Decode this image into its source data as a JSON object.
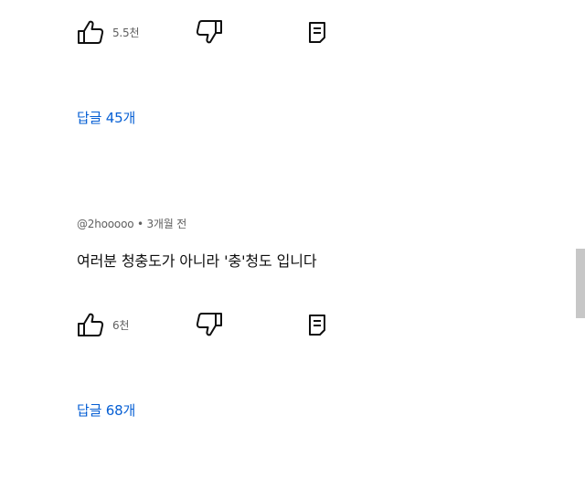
{
  "comments": [
    {
      "like_count": "5.5천",
      "replies_label": "답글 45개"
    },
    {
      "handle": "@2hooooo",
      "separator": "•",
      "time": "3개월 전",
      "text": "여러분 청충도가 아니라 '충'청도 입니다",
      "like_count": "6천",
      "replies_label": "답글 68개"
    }
  ],
  "icons": {
    "like": "thumbs-up-icon",
    "dislike": "thumbs-down-icon",
    "reply": "reply-comment-icon"
  },
  "colors": {
    "link": "#065fd4",
    "secondary_text": "#606060",
    "primary_text": "#0f0f0f",
    "scrollbar": "#c7c7c7"
  }
}
